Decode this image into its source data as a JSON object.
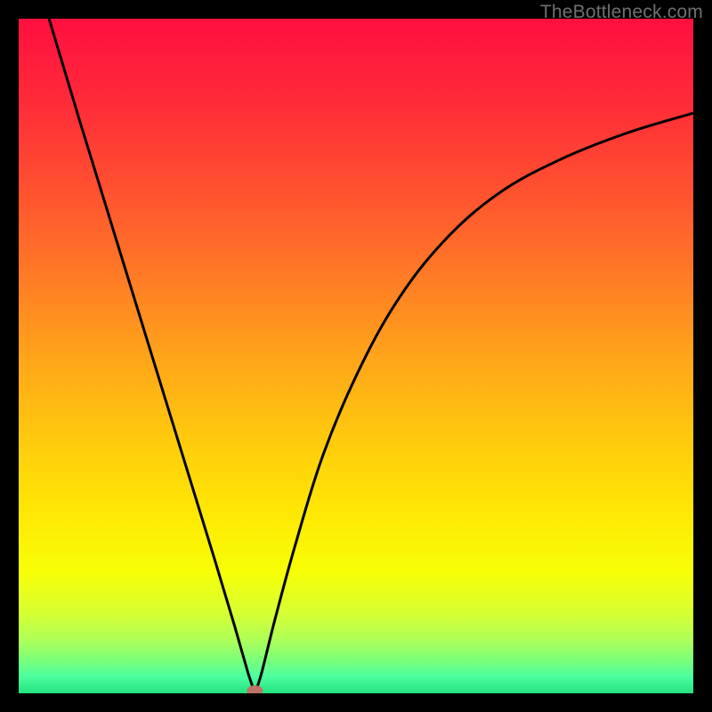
{
  "watermark": "TheBottleneck.com",
  "chart_data": {
    "type": "line",
    "title": "",
    "xlabel": "",
    "ylabel": "",
    "xlim": [
      0,
      100
    ],
    "ylim": [
      0,
      100
    ],
    "min_point": {
      "x": 35,
      "y": 0
    },
    "curve_left": [
      {
        "x": 4.5,
        "y": 100
      },
      {
        "x": 9,
        "y": 85
      },
      {
        "x": 13,
        "y": 72
      },
      {
        "x": 17,
        "y": 59
      },
      {
        "x": 21,
        "y": 46
      },
      {
        "x": 25,
        "y": 33
      },
      {
        "x": 29,
        "y": 20
      },
      {
        "x": 32,
        "y": 10
      },
      {
        "x": 34,
        "y": 3
      },
      {
        "x": 35,
        "y": 0
      }
    ],
    "curve_right": [
      {
        "x": 35,
        "y": 0
      },
      {
        "x": 36,
        "y": 3
      },
      {
        "x": 38,
        "y": 11
      },
      {
        "x": 41,
        "y": 22
      },
      {
        "x": 45,
        "y": 35
      },
      {
        "x": 50,
        "y": 47
      },
      {
        "x": 56,
        "y": 58
      },
      {
        "x": 63,
        "y": 67
      },
      {
        "x": 71,
        "y": 74
      },
      {
        "x": 80,
        "y": 79
      },
      {
        "x": 90,
        "y": 83
      },
      {
        "x": 100,
        "y": 86
      }
    ],
    "gradient_stops": [
      {
        "offset": 0,
        "color": "#ff0f3f"
      },
      {
        "offset": 12,
        "color": "#ff2a38"
      },
      {
        "offset": 25,
        "color": "#ff5030"
      },
      {
        "offset": 38,
        "color": "#ff7a26"
      },
      {
        "offset": 50,
        "color": "#ffa41a"
      },
      {
        "offset": 62,
        "color": "#ffc90e"
      },
      {
        "offset": 73,
        "color": "#ffe705"
      },
      {
        "offset": 82,
        "color": "#f7ff06"
      },
      {
        "offset": 88,
        "color": "#d8ff32"
      },
      {
        "offset": 92,
        "color": "#b0ff58"
      },
      {
        "offset": 95,
        "color": "#7cff78"
      },
      {
        "offset": 97.5,
        "color": "#4dffa0"
      },
      {
        "offset": 100,
        "color": "#23e27e"
      }
    ],
    "marker_color": "#bd7366"
  }
}
